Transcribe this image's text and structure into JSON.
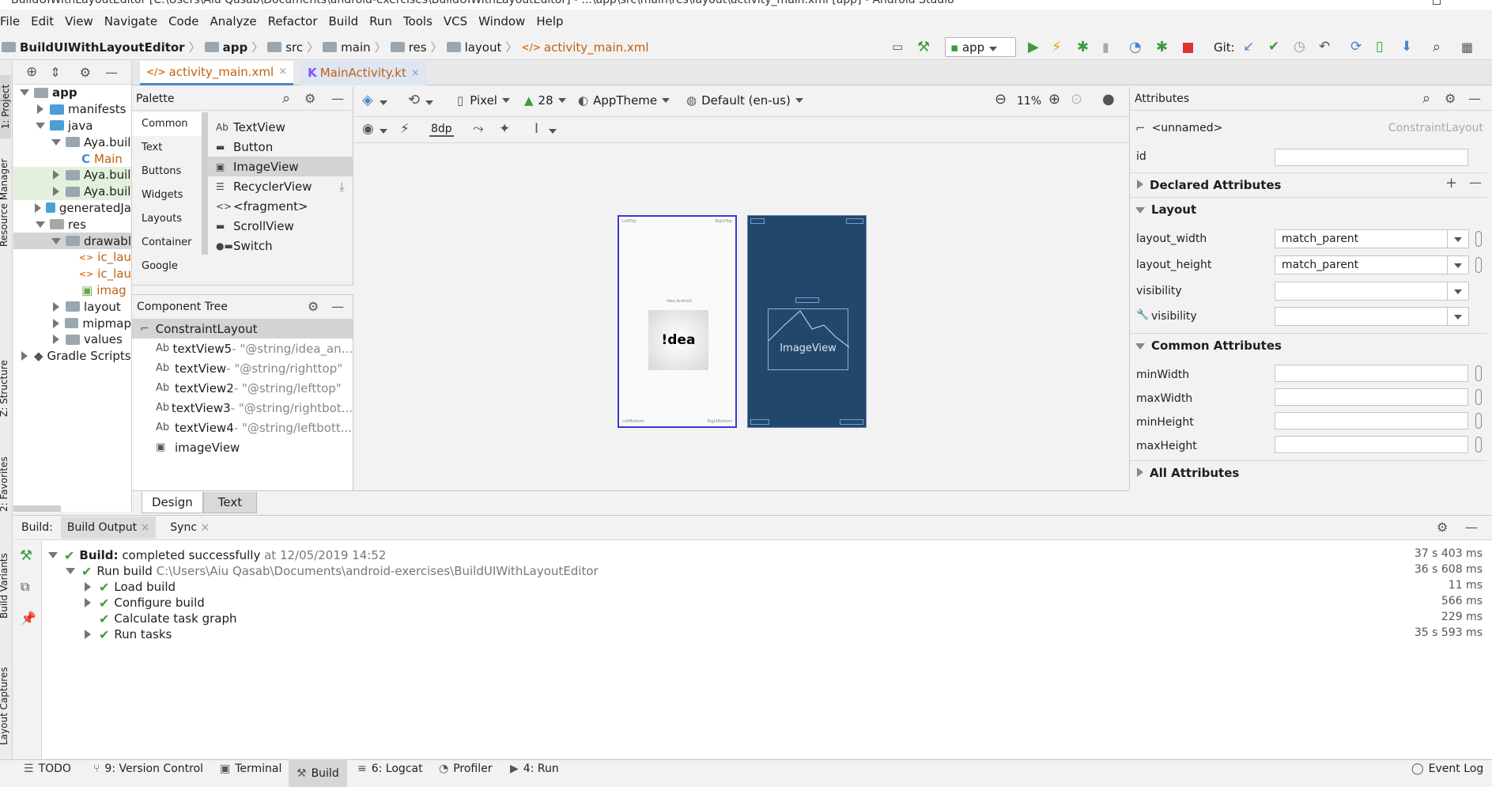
{
  "window": {
    "title": "BuildUIWithLayoutEditor [C:\\Users\\Aiu Qasab\\Documents\\android-exercises\\BuildUIWithLayoutEditor] - ...\\app\\src\\main\\res\\layout\\activity_main.xml [app] - Android Studio"
  },
  "menu": [
    "File",
    "Edit",
    "View",
    "Navigate",
    "Code",
    "Analyze",
    "Refactor",
    "Build",
    "Run",
    "Tools",
    "VCS",
    "Window",
    "Help"
  ],
  "breadcrumb": [
    "BuildUIWithLayoutEditor",
    "app",
    "src",
    "main",
    "res",
    "layout",
    "activity_main.xml"
  ],
  "toolbar": {
    "run_config": "app",
    "git_label": "Git:"
  },
  "left_strip": [
    "1: Project",
    "Resource Manager",
    "Z: Structure",
    "2: Favorites",
    "Build Variants",
    "Layout Captures"
  ],
  "project_tree": [
    {
      "label": "app",
      "indent": 0,
      "arrow": "down",
      "icon": "folder",
      "bold": true
    },
    {
      "label": "manifests",
      "indent": 1,
      "arrow": "right",
      "icon": "folder-blue"
    },
    {
      "label": "java",
      "indent": 1,
      "arrow": "down",
      "icon": "folder-blue"
    },
    {
      "label": "Aya.buil",
      "indent": 2,
      "arrow": "down",
      "icon": "folder",
      "hl": "none"
    },
    {
      "label": "Main",
      "indent": 3,
      "arrow": "none",
      "icon": "kotlin",
      "orange": true
    },
    {
      "label": "Aya.buil",
      "indent": 2,
      "arrow": "right",
      "icon": "folder",
      "hl": "green"
    },
    {
      "label": "Aya.buil",
      "indent": 2,
      "arrow": "right",
      "icon": "folder",
      "hl": "green"
    },
    {
      "label": "generatedJa",
      "indent": 1,
      "arrow": "right",
      "icon": "folder-blue"
    },
    {
      "label": "res",
      "indent": 1,
      "arrow": "down",
      "icon": "folder-gray"
    },
    {
      "label": "drawabl",
      "indent": 2,
      "arrow": "down",
      "icon": "folder",
      "hl": "gray"
    },
    {
      "label": "ic_lau",
      "indent": 3,
      "arrow": "none",
      "icon": "xml",
      "orange": true
    },
    {
      "label": "ic_lau",
      "indent": 3,
      "arrow": "none",
      "icon": "xml",
      "orange": true
    },
    {
      "label": "imag",
      "indent": 3,
      "arrow": "none",
      "icon": "image",
      "orange": true
    },
    {
      "label": "layout",
      "indent": 2,
      "arrow": "right",
      "icon": "folder"
    },
    {
      "label": "mipmap",
      "indent": 2,
      "arrow": "right",
      "icon": "folder"
    },
    {
      "label": "values",
      "indent": 2,
      "arrow": "right",
      "icon": "folder"
    },
    {
      "label": "Gradle Scripts",
      "indent": 0,
      "arrow": "right",
      "icon": "gradle"
    }
  ],
  "editor_tabs": [
    {
      "label": "activity_main.xml",
      "active": true
    },
    {
      "label": "MainActivity.kt",
      "active": false
    }
  ],
  "palette": {
    "title": "Palette",
    "categories": [
      "Common",
      "Text",
      "Buttons",
      "Widgets",
      "Layouts",
      "Container",
      "Google"
    ],
    "items": [
      {
        "icon": "Ab",
        "label": "TextView"
      },
      {
        "icon": "▬",
        "label": "Button"
      },
      {
        "icon": "▣",
        "label": "ImageView"
      },
      {
        "icon": "☰",
        "label": "RecyclerView"
      },
      {
        "icon": "<>",
        "label": "<fragment>"
      },
      {
        "icon": "▬",
        "label": "ScrollView"
      },
      {
        "icon": "●▬",
        "label": "Switch"
      }
    ]
  },
  "component_tree": {
    "title": "Component Tree",
    "root": "ConstraintLayout",
    "items": [
      {
        "icon": "Ab",
        "name": "textView5",
        "value": "- \"@string/idea_an..."
      },
      {
        "icon": "Ab",
        "name": "textView",
        "value": "- \"@string/righttop\""
      },
      {
        "icon": "Ab",
        "name": "textView2",
        "value": "- \"@string/lefttop\""
      },
      {
        "icon": "Ab",
        "name": "textView3",
        "value": "- \"@string/rightbot..."
      },
      {
        "icon": "Ab",
        "name": "textView4",
        "value": "- \"@string/leftbott..."
      },
      {
        "icon": "▣",
        "name": "imageView",
        "value": ""
      }
    ]
  },
  "design_toolbar": {
    "device": "Pixel",
    "api": "28",
    "theme": "AppTheme",
    "locale": "Default (en-us)",
    "zoom": "11%",
    "margin": "8dp"
  },
  "preview": {
    "idea_label": "!dea",
    "imageview_label": "ImageView",
    "tiny": [
      "LeftTop",
      "RightTop",
      "LeftBottom",
      "RightBottom",
      "Idea Android"
    ]
  },
  "bottom_tabs": [
    "Design",
    "Text"
  ],
  "attributes": {
    "title": "Attributes",
    "component": "<unnamed>",
    "component_type": "ConstraintLayout",
    "id_label": "id",
    "declared": "Declared Attributes",
    "layout_header": "Layout",
    "layout_width_label": "layout_width",
    "layout_width": "match_parent",
    "layout_height_label": "layout_height",
    "layout_height": "match_parent",
    "visibility_label": "visibility",
    "visibility2_label": "visibility",
    "common_header": "Common Attributes",
    "minWidth": "minWidth",
    "maxWidth": "maxWidth",
    "minHeight": "minHeight",
    "maxHeight": "maxHeight",
    "all": "All Attributes"
  },
  "build_panel": {
    "label": "Build:",
    "tabs": [
      "Build Output",
      "Sync"
    ],
    "rows": [
      {
        "bold": "Build:",
        "text": " completed successfully",
        "muted": " at 12/05/2019 14:52",
        "time": "37 s 403 ms",
        "indent": 0,
        "arrow": "down"
      },
      {
        "bold": "",
        "text": "Run build",
        "muted": " C:\\Users\\Aiu Qasab\\Documents\\android-exercises\\BuildUIWithLayoutEditor",
        "time": "36 s 608 ms",
        "indent": 1,
        "arrow": "down"
      },
      {
        "bold": "",
        "text": "Load build",
        "muted": "",
        "time": "11 ms",
        "indent": 2,
        "arrow": "right"
      },
      {
        "bold": "",
        "text": "Configure build",
        "muted": "",
        "time": "566 ms",
        "indent": 2,
        "arrow": "right"
      },
      {
        "bold": "",
        "text": "Calculate task graph",
        "muted": "",
        "time": "229 ms",
        "indent": 2,
        "arrow": "none"
      },
      {
        "bold": "",
        "text": "Run tasks",
        "muted": "",
        "time": "35 s 593 ms",
        "indent": 2,
        "arrow": "right"
      }
    ]
  },
  "status_bar": {
    "todo": "TODO",
    "vc": "9: Version Control",
    "terminal": "Terminal",
    "build": "Build",
    "logcat": "6: Logcat",
    "profiler": "Profiler",
    "run": "4: Run",
    "event_log": "Event Log"
  },
  "colors": {
    "blueprint": "#22476b",
    "accent": "#4a86c8",
    "green": "#3c9b3c"
  }
}
